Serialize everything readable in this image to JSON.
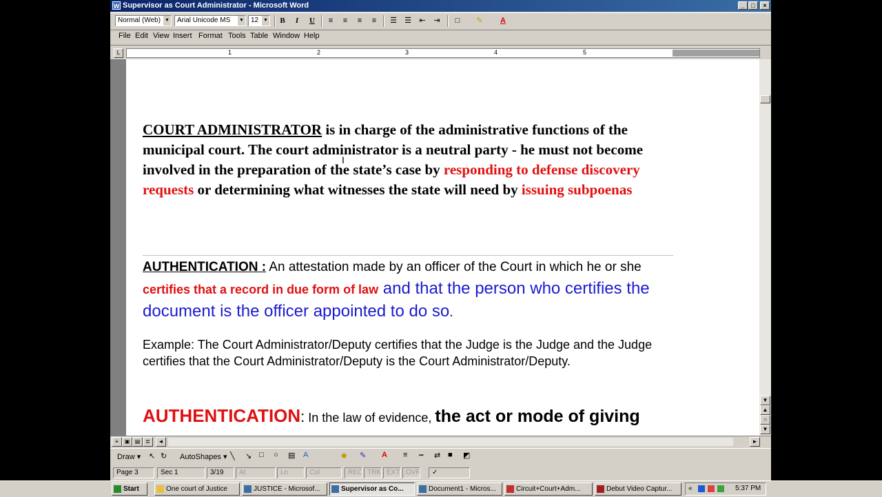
{
  "window": {
    "title": "Supervisor as Court Administrator - Microsoft Word"
  },
  "toolbar": {
    "style": "Normal (Web)",
    "font": "Arial Unicode MS",
    "size": "12",
    "bold": "B",
    "italic": "I",
    "underline": "U"
  },
  "menu": [
    "File",
    "Edit",
    "View",
    "Insert",
    "Format",
    "Tools",
    "Table",
    "Window",
    "Help"
  ],
  "ruler": [
    "1",
    "2",
    "3",
    "4",
    "5"
  ],
  "doc": {
    "p1_term": "COURT ADMINISTRATOR",
    "p1_a": " is in charge of the administrative functions of the municipal court. The court administrator is a neutral party - he must not become involved in the preparation of the state’s case by ",
    "p1_red1": "responding to defense discovery requests",
    "p1_b": " or determining what witnesses the state will need by ",
    "p1_red2": "issuing subpoenas",
    "p2_term": "AUTHENTICATION :",
    "p2_a": " An attestation made by an officer of the Court in which he or she ",
    "p2_red": "certifies that a record in due form of law",
    "p2_blue": " and that the person who certifies the document is the officer appointed to do so",
    "p2_end": ".",
    "p3": "Example: The Court Administrator/Deputy certifies that the Judge is the Judge and the Judge certifies that the Court Administrator/Deputy is the Court Administrator/Deputy.",
    "p4_term": "AUTHENTICATION",
    "p4_colon": ":",
    "p4_a": " In the law of evidence, ",
    "p4_bold": "the act or mode of giving authority or legal authenticity to a statute, record"
  },
  "drawbar": {
    "draw": "Draw ▾",
    "autoshapes": "AutoShapes ▾"
  },
  "status": {
    "page": "Page 3",
    "sec": "Sec 1",
    "pages": "3/19",
    "at": "At",
    "ln": "Ln",
    "col": "Col",
    "rec": "REC",
    "trk": "TRK",
    "ext": "EXT",
    "ovr": "OVR"
  },
  "taskbar": {
    "start": "Start",
    "tasks": [
      "One court of Justice",
      "JUSTICE - Microsof...",
      "Supervisor as Co...",
      "Document1 - Micros...",
      "Circuit+Court+Adm...",
      "Debut Video Captur..."
    ],
    "clock": "5:37 PM"
  }
}
